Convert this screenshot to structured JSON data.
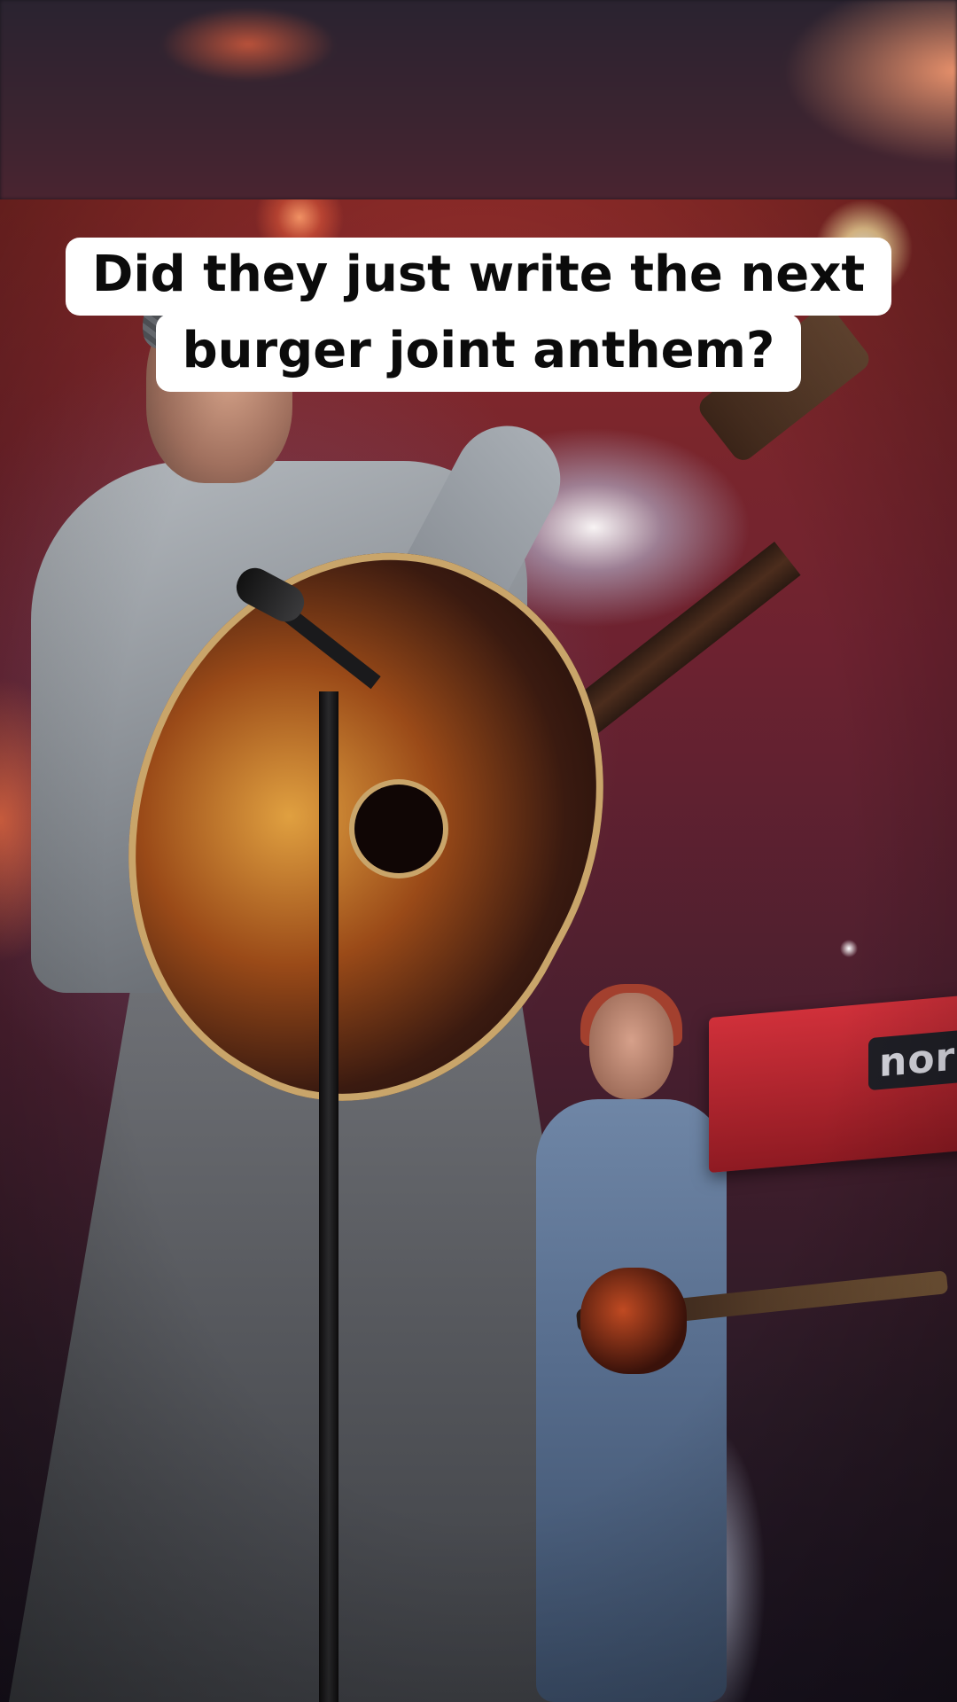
{
  "caption": {
    "line1": "Did they just write the next",
    "line2": "burger joint anthem?"
  },
  "keyboard": {
    "logo_text": "nord"
  },
  "colors": {
    "caption_background": "#ffffff",
    "caption_text": "#0b0b0b",
    "stage_red": "#8a2a28",
    "keyboard_red": "#d0303a"
  }
}
